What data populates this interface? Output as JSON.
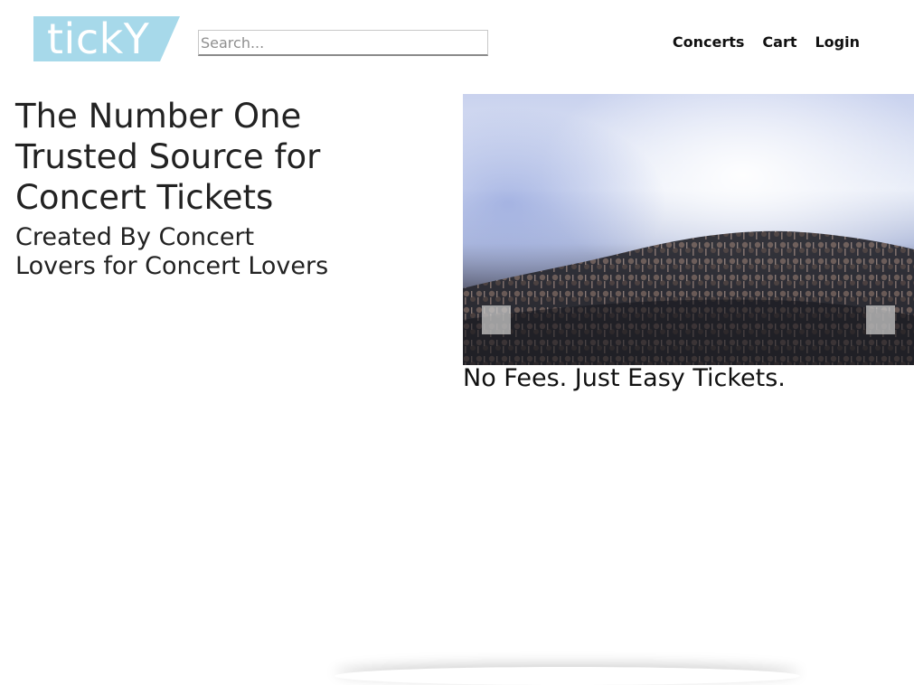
{
  "brand": {
    "logo_text": "tickY",
    "logo_color": "#a7d9ea"
  },
  "search": {
    "placeholder": "Search..."
  },
  "nav": {
    "items": [
      {
        "label": "Concerts"
      },
      {
        "label": "Cart"
      },
      {
        "label": "Login"
      }
    ]
  },
  "hero": {
    "title": "The Number One Trusted Source for Concert Tickets",
    "subtitle": "Created By Concert Lovers for Concert Lovers"
  },
  "carousel": {
    "image": "concert-crowd-image",
    "prev_icon": "chevron-left-icon",
    "next_icon": "chevron-right-icon",
    "caption": "No Fees. Just Easy Tickets."
  }
}
